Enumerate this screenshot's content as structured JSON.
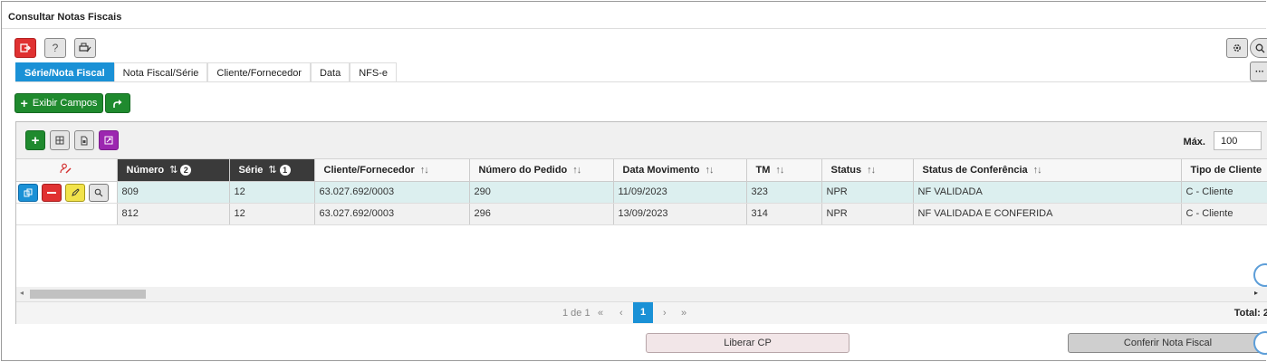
{
  "window": {
    "title": "Consultar Notas Fiscais"
  },
  "toolbar": {
    "exit_icon": "exit-icon",
    "help_label": "?",
    "print_icon": "print-icon",
    "settings_icon": "gear-icon",
    "search_icon": "search-icon",
    "more_label": "···"
  },
  "tabs": [
    {
      "label": "Série/Nota Fiscal",
      "active": true
    },
    {
      "label": "Nota Fiscal/Série"
    },
    {
      "label": "Cliente/Fornecedor"
    },
    {
      "label": "Data"
    },
    {
      "label": "NFS-e"
    }
  ],
  "actions": {
    "exibir_campos": "Exibir Campos"
  },
  "grid": {
    "max_label": "Máx.",
    "max_value": "100",
    "columns": [
      {
        "label": "Número",
        "sort": "⇅",
        "badge": "2"
      },
      {
        "label": "Série",
        "sort": "⇅",
        "badge": "1"
      },
      {
        "label": "Cliente/Fornecedor",
        "sort": "↑↓"
      },
      {
        "label": "Número do Pedido",
        "sort": "↑↓"
      },
      {
        "label": "Data Movimento",
        "sort": "↑↓"
      },
      {
        "label": "TM",
        "sort": "↑↓"
      },
      {
        "label": "Status",
        "sort": "↑↓"
      },
      {
        "label": "Status de Conferência",
        "sort": "↑↓"
      },
      {
        "label": "Tipo de Cliente",
        "sort": "↑↓"
      }
    ],
    "rows": [
      {
        "numero": "809",
        "serie": "12",
        "cliente": "63.027.692/0003",
        "pedido": "290",
        "data": "11/09/2023",
        "tm": "323",
        "status": "NPR",
        "conferencia": "NF VALIDADA",
        "tipo": "C - Cliente"
      },
      {
        "numero": "812",
        "serie": "12",
        "cliente": "63.027.692/0003",
        "pedido": "296",
        "data": "13/09/2023",
        "tm": "314",
        "status": "NPR",
        "conferencia": "NF VALIDADA E CONFERIDA",
        "tipo": "C - Cliente"
      }
    ],
    "pager": {
      "page_info": "1 de 1",
      "first": "«",
      "prev": "‹",
      "current": "1",
      "next": "›",
      "last": "»",
      "total": "Total: 2"
    }
  },
  "footer": {
    "liberar": "Liberar CP",
    "conferir": "Conferir Nota Fiscal"
  },
  "colors": {
    "accent": "#1a91d6",
    "green": "#1f8a2e",
    "red": "#e03131",
    "purple": "#9c27b0",
    "yellow": "#f2e34b"
  }
}
